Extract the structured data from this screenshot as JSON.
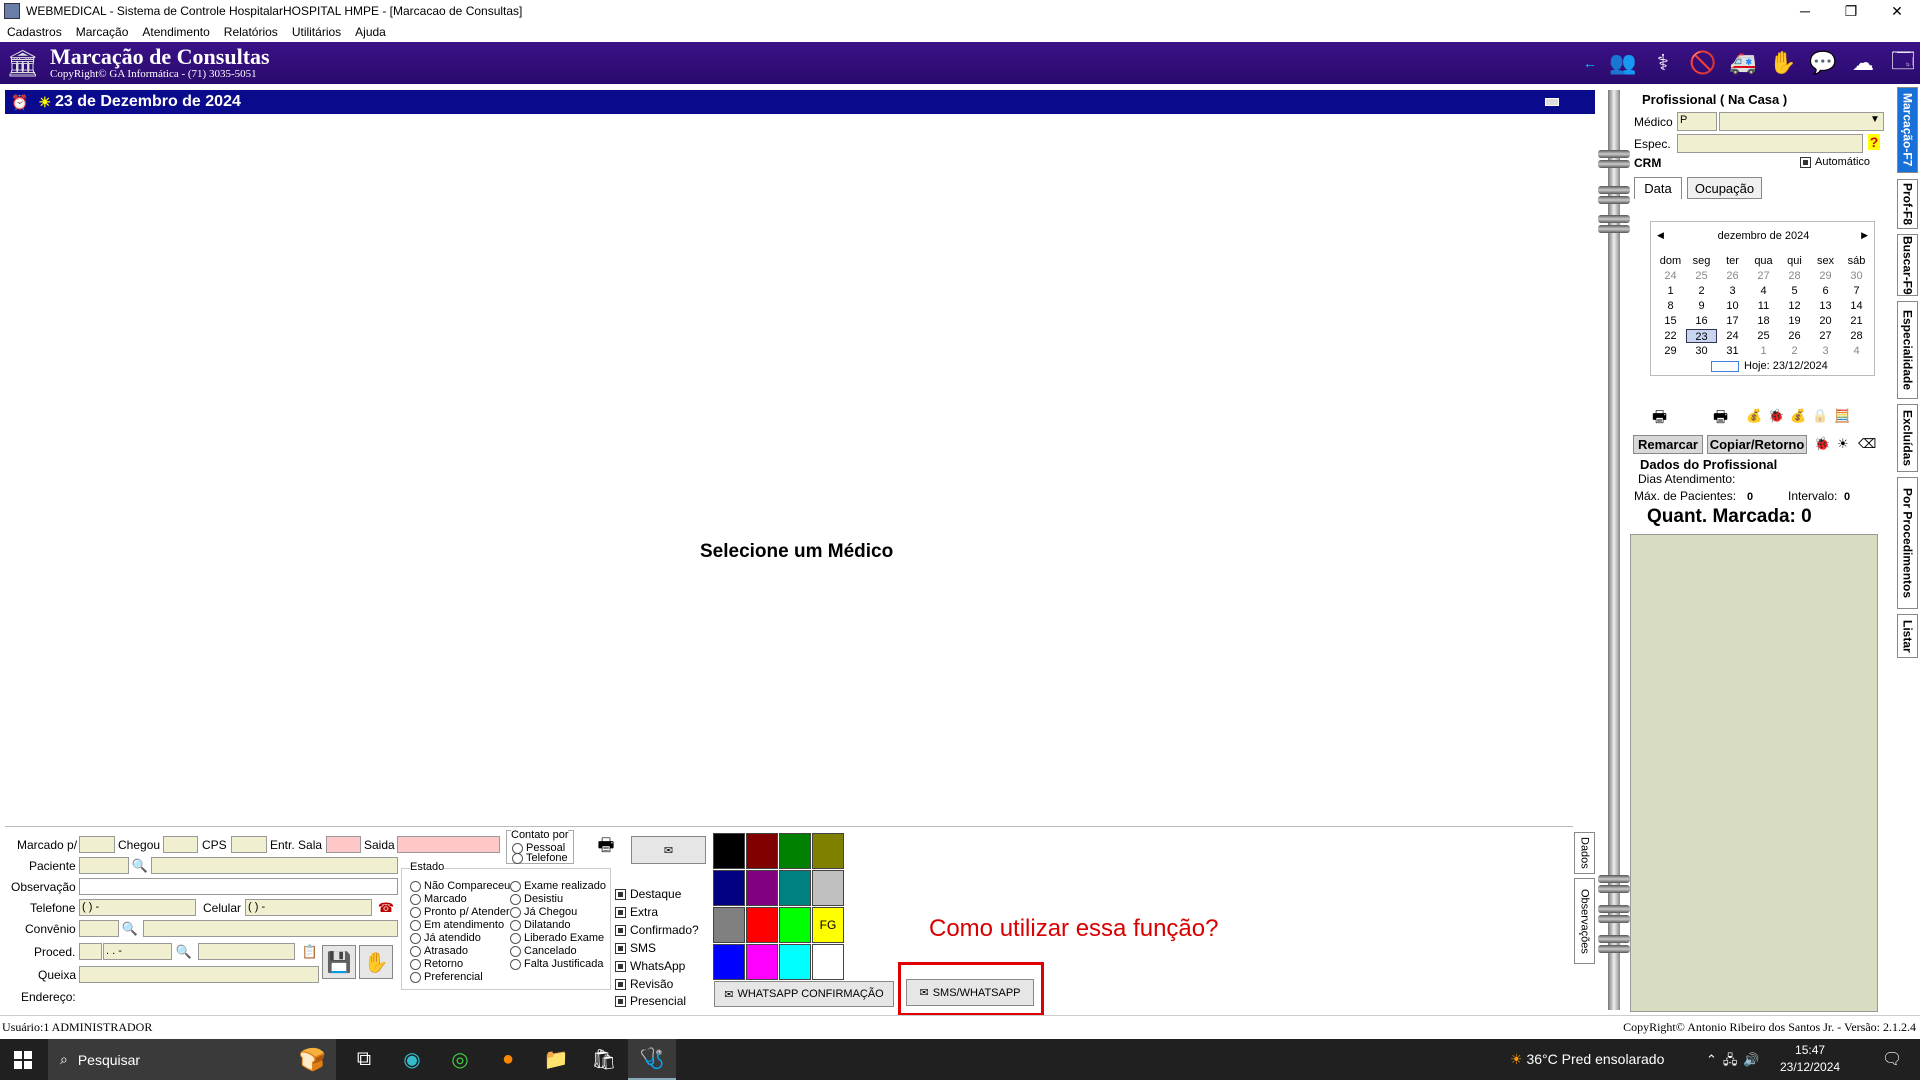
{
  "window": {
    "title": "WEBMEDICAL - Sistema de Controle HospitalarHOSPITAL HMPE - [Marcacao de Consultas]",
    "minimize": "─",
    "maximize": "❐",
    "close": "✕"
  },
  "menu": [
    "Cadastros",
    "Marcação",
    "Atendimento",
    "Relatórios",
    "Utilitários",
    "Ajuda"
  ],
  "header": {
    "title": "Marcação de Consultas",
    "subtitle": "CopyRight© GA Informática - (71) 3035-5051"
  },
  "datebar": {
    "date": "23 de Dezembro de 2024"
  },
  "main": {
    "placeholder": "Selecione um Médico"
  },
  "form": {
    "marcado_p": "Marcado p/",
    "chegou": "Chegou",
    "cps": "CPS",
    "entr_sala": "Entr. Sala",
    "saida": "Saida",
    "contato_por": "Contato por",
    "pessoal": "Pessoal",
    "telefone_opt": "Telefone",
    "paciente": "Paciente",
    "observacao": "Observação",
    "telefone": "Telefone",
    "telefone_val": "(  )      -",
    "celular": "Celular",
    "celular_val": "(  )      -",
    "convenio": "Convênio",
    "proced": "Proced.",
    "proced_val": " .  .   -",
    "queixa": "Queixa",
    "endereco": "Endereço:"
  },
  "estado": {
    "title": "Estado",
    "col1": [
      "Não Compareceu",
      "Marcado",
      "Pronto p/ Atender",
      "Em atendimento",
      "Já atendido",
      "Atrasado",
      "Retorno",
      "Preferencial"
    ],
    "col2": [
      "Exame realizado",
      "Desistiu",
      "Já Chegou",
      "Dilatando",
      "Liberado Exame",
      "Cancelado",
      "Falta Justificada"
    ]
  },
  "flags": [
    "Destaque",
    "Extra",
    "Confirmado?",
    "SMS",
    "WhatsApp",
    "Revisão",
    "Presencial"
  ],
  "swatches": {
    "colors": [
      "#000000",
      "#800000",
      "#008000",
      "#808000",
      "#000080",
      "#800080",
      "#008080",
      "#c0c0c0",
      "#808080",
      "#ff0000",
      "#00ff00",
      "#ffff00",
      "#0000ff",
      "#ff00ff",
      "#00ffff",
      "#ffffff"
    ],
    "fg_label": "FG"
  },
  "buttons": {
    "whatsapp_confirmacao": "WHATSAPP CONFIRMAÇÃO",
    "sms_whatsapp": "SMS/WHATSAPP",
    "remarcar": "Remarcar",
    "copiar_retorno": "Copiar/Retorno"
  },
  "annotation": "Como utilizar essa função?",
  "vtabs_bottom": [
    "Dados",
    "Observações"
  ],
  "profissional": {
    "title": "Profissional ( Na Casa )",
    "medico": "Médico",
    "medico_val": "P",
    "espec": "Espec.",
    "crm": "CRM",
    "automatico": "Automático",
    "tab_data": "Data",
    "tab_ocupacao": "Ocupação",
    "dados_title": "Dados do Profissional",
    "dias_atend": "Dias Atendimento:",
    "max_pac": "Máx. de Pacientes:",
    "max_pac_val": "0",
    "intervalo": "Intervalo:",
    "intervalo_val": "0",
    "quant_marcada": "Quant. Marcada: 0"
  },
  "calendar": {
    "month": "dezembro de 2024",
    "weekdays": [
      "dom",
      "seg",
      "ter",
      "qua",
      "qui",
      "sex",
      "sáb"
    ],
    "days": [
      "24",
      "25",
      "26",
      "27",
      "28",
      "29",
      "30",
      "1",
      "2",
      "3",
      "4",
      "5",
      "6",
      "7",
      "8",
      "9",
      "10",
      "11",
      "12",
      "13",
      "14",
      "15",
      "16",
      "17",
      "18",
      "19",
      "20",
      "21",
      "22",
      "23",
      "24",
      "25",
      "26",
      "27",
      "28",
      "29",
      "30",
      "31",
      "1",
      "2",
      "3",
      "4"
    ],
    "today_label": "Hoje: 23/12/2024"
  },
  "side_tabs": [
    "Marcação-F7",
    "Prof-F8",
    "Buscar-F9",
    "Especialidade",
    "Excluídas",
    "Por Procedimentos",
    "Listar"
  ],
  "status": {
    "left": "Usuário:1 ADMINISTRADOR",
    "right": "CopyRight© Antonio Ribeiro dos Santos Jr. - Versão: 2.1.2.4"
  },
  "taskbar": {
    "search": "Pesquisar",
    "weather": "36°C  Pred ensolarado",
    "time": "15:47",
    "date": "23/12/2024"
  }
}
